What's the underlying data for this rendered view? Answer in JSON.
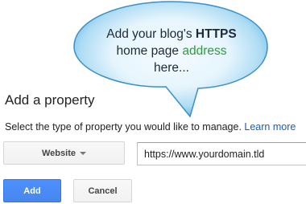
{
  "callout": {
    "line1_prefix": "Add your blog's ",
    "line1_highlight": "HTTPS",
    "line2_prefix": "home page ",
    "line2_highlight": "address",
    "line3": "here..."
  },
  "form": {
    "heading": "Add a property",
    "instruction": "Select the type of property you would like to manage.",
    "learn_more": "Learn more",
    "property_type": "Website",
    "url_value": "https://www.yourdomain.tld",
    "add_label": "Add",
    "cancel_label": "Cancel"
  },
  "icons": {
    "type_dropdown": "chevron-down-icon"
  },
  "colors": {
    "callout_fill_center": "#f5fbff",
    "callout_fill_edge": "#6fc2ec",
    "callout_stroke": "#3d8fc7",
    "link": "#1a5bc4",
    "primary_button": "#4d90fe",
    "highlight_green": "#2e9a3a"
  }
}
